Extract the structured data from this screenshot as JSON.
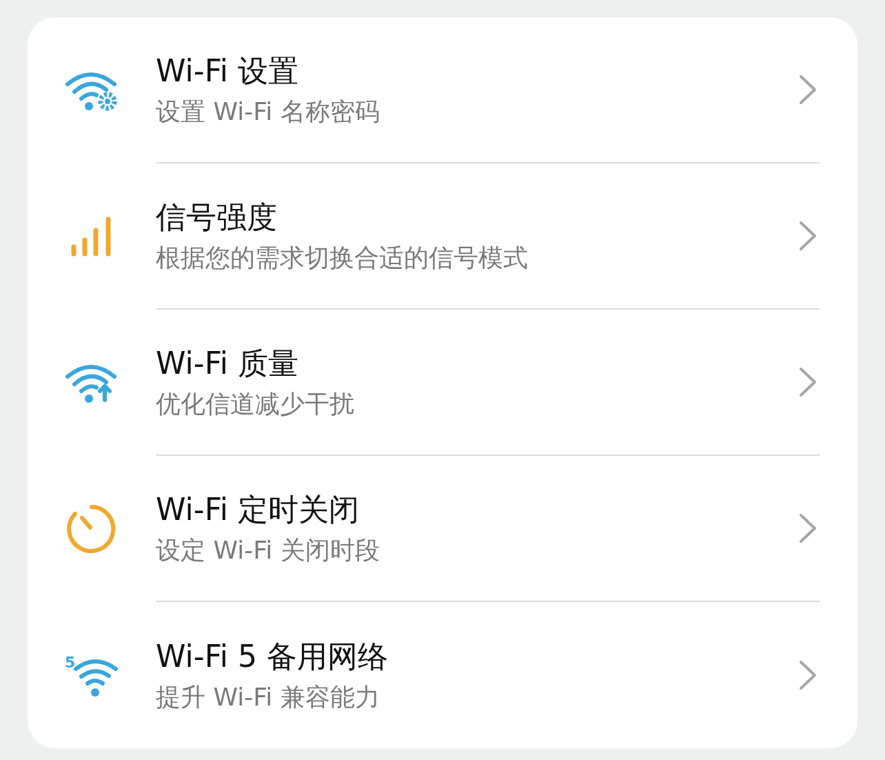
{
  "items": [
    {
      "icon": {
        "kind": "wifi-gear"
      },
      "title": "Wi-Fi 设置",
      "subtitle": "设置 Wi-Fi 名称密码"
    },
    {
      "icon": {
        "kind": "signal"
      },
      "title": "信号强度",
      "subtitle": "根据您的需求切换合适的信号模式"
    },
    {
      "icon": {
        "kind": "wifi-arrow"
      },
      "title": "Wi-Fi 质量",
      "subtitle": "优化信道减少干扰"
    },
    {
      "icon": {
        "kind": "timer"
      },
      "title": "Wi-Fi 定时关闭",
      "subtitle": "设定 Wi-Fi 关闭时段"
    },
    {
      "icon": {
        "kind": "wifi-5",
        "badge": "5"
      },
      "title": "Wi-Fi 5 备用网络",
      "subtitle": "提升 Wi-Fi 兼容能力"
    }
  ]
}
